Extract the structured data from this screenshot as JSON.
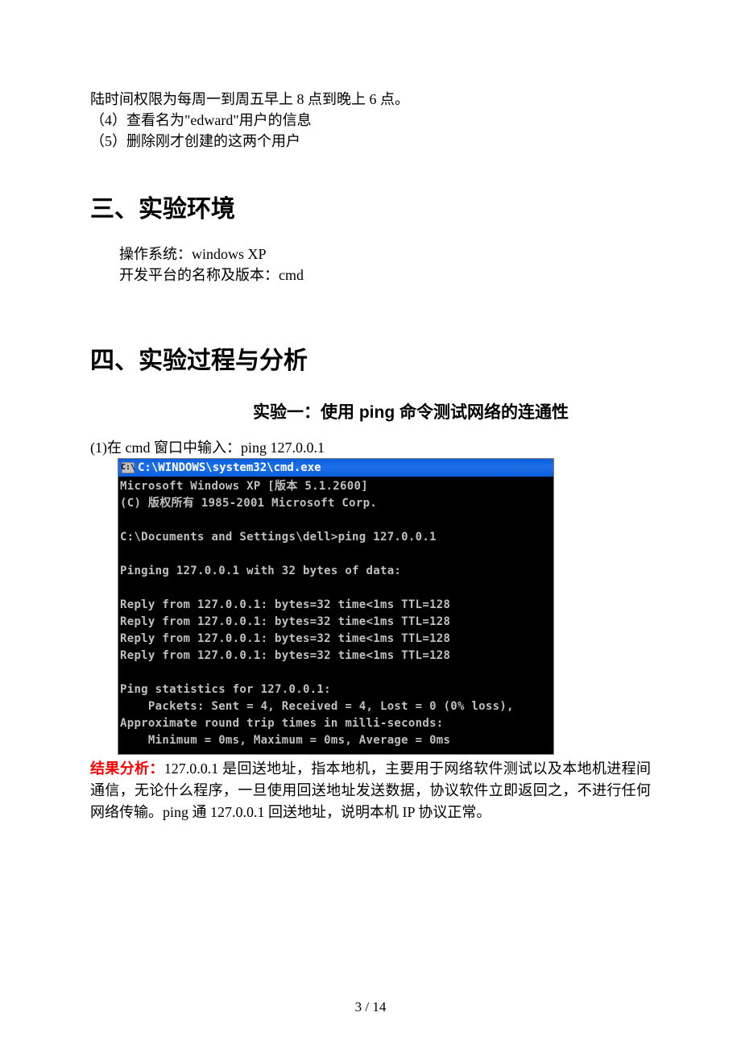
{
  "top": {
    "line1": "陆时间权限为每周一到周五早上 8 点到晚上 6 点。",
    "line2": "（4）查看名为\"edward\"用户的信息",
    "line3": "（5）删除刚才创建的这两个用户"
  },
  "section3": {
    "heading": "三、实验环境",
    "os": "操作系统：windows XP",
    "platform": "开发平台的名称及版本：cmd"
  },
  "section4": {
    "heading": "四、实验过程与分析",
    "exp1_title": "实验一：使用 ping 命令测试网络的连通性",
    "step1": "(1)在 cmd 窗口中输入：ping 127.0.0.1"
  },
  "cmd": {
    "icon_text": "C:\\",
    "title": "C:\\WINDOWS\\system32\\cmd.exe",
    "l1": "Microsoft Windows XP [版本 5.1.2600]",
    "l2": "(C) 版权所有 1985-2001 Microsoft Corp.",
    "l3": "",
    "l4": "C:\\Documents and Settings\\dell>ping 127.0.0.1",
    "l5": "",
    "l6": "Pinging 127.0.0.1 with 32 bytes of data:",
    "l7": "",
    "l8": "Reply from 127.0.0.1: bytes=32 time<1ms TTL=128",
    "l9": "Reply from 127.0.0.1: bytes=32 time<1ms TTL=128",
    "l10": "Reply from 127.0.0.1: bytes=32 time<1ms TTL=128",
    "l11": "Reply from 127.0.0.1: bytes=32 time<1ms TTL=128",
    "l12": "",
    "l13": "Ping statistics for 127.0.0.1:",
    "l14": "    Packets: Sent = 4, Received = 4, Lost = 0 (0% loss),",
    "l15": "Approximate round trip times in milli-seconds:",
    "l16": "    Minimum = 0ms, Maximum = 0ms, Average = 0ms"
  },
  "analysis": {
    "label": "结果分析：",
    "text": "127.0.0.1 是回送地址，指本地机，主要用于网络软件测试以及本地机进程间通信，无论什么程序，一旦使用回送地址发送数据，协议软件立即返回之，不进行任何网络传输。ping 通 127.0.0.1 回送地址，说明本机 IP 协议正常。"
  },
  "page_number": "3  /  14"
}
